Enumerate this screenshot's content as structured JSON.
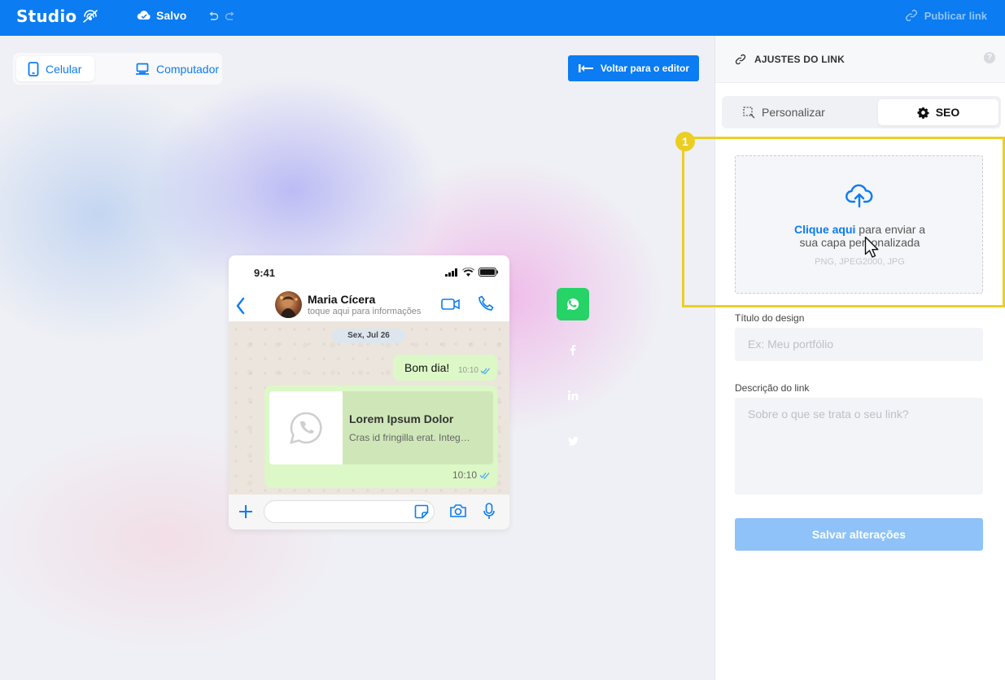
{
  "topbar": {
    "brand": "Studio",
    "save_status": "Salvo",
    "publish_label": "Publicar link"
  },
  "canvas": {
    "device_toggle": {
      "mobile_label": "Celular",
      "desktop_label": "Computador"
    },
    "back_to_editor_label": "Voltar para o editor"
  },
  "phone": {
    "status_time": "9:41",
    "contact_name": "Maria Cícera",
    "contact_subtitle": "toque aqui para informações",
    "date_pill": "Sex, Jul 26",
    "message_text": "Bom dia!",
    "message_time": "10:10",
    "preview_title": "Lorem Ipsum Dolor",
    "preview_desc": "Cras id fringilla erat. Integ…",
    "preview_time": "10:10"
  },
  "share_icons": [
    "whatsapp-icon",
    "facebook-icon",
    "linkedin-icon",
    "twitter-icon"
  ],
  "panel": {
    "title": "AJUSTES DO LINK",
    "help": "?",
    "tabs": [
      {
        "label": "Personalizar",
        "active": false
      },
      {
        "label": "SEO",
        "active": true
      }
    ],
    "upload": {
      "link_text": "Clique aqui",
      "rest_line1": " para enviar a",
      "line2": "sua capa personalizada",
      "formats": "PNG, JPEG2000, JPG"
    },
    "design_title_label": "Título do design",
    "design_title_placeholder": "Ex: Meu portfólio",
    "description_label": "Descrição do link",
    "description_placeholder": "Sobre o que se trata o seu link?",
    "save_label": "Salvar alterações"
  },
  "annotation": {
    "badge": "1"
  },
  "colors": {
    "primary": "#0b7cf2",
    "whatsapp": "#25d366",
    "annotation": "#ecce22",
    "save_disabled": "#8ec2f8"
  }
}
